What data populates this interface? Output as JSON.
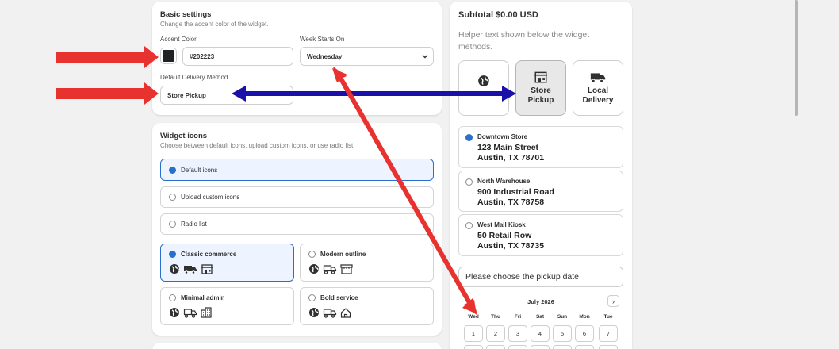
{
  "basic": {
    "title": "Basic settings",
    "subtitle": "Change the accent color of the widget.",
    "accent_label": "Accent Color",
    "accent_value": "#202223",
    "accent_color": "#202223",
    "week_label": "Week Starts On",
    "week_value": "Wednesday",
    "delivery_label": "Default Delivery Method",
    "delivery_value": "Store Pickup"
  },
  "icons": {
    "title": "Widget icons",
    "subtitle": "Choose between default icons, upload custom icons, or use radio list.",
    "options": [
      "Default icons",
      "Upload custom icons",
      "Radio list"
    ],
    "selected_option": "Default icons",
    "sets": [
      {
        "label": "Classic commerce",
        "selected": true,
        "icons": [
          "globe-icon",
          "truck-icon",
          "store-icon"
        ]
      },
      {
        "label": "Modern outline",
        "selected": false,
        "icons": [
          "globe-icon",
          "truck-outline-icon",
          "store-outline-icon"
        ]
      },
      {
        "label": "Minimal admin",
        "selected": false,
        "icons": [
          "globe-icon",
          "truck-outline-icon",
          "building-icon"
        ]
      },
      {
        "label": "Bold service",
        "selected": false,
        "icons": [
          "globe-icon",
          "truck-outline-icon",
          "house-icon"
        ]
      }
    ]
  },
  "preview": {
    "subtotal": "Subtotal $0.00 USD",
    "helper": "Helper text shown below the widget methods.",
    "methods": [
      {
        "label": "",
        "icon": "globe-icon",
        "selected": false
      },
      {
        "label": "Store Pickup",
        "icon": "store-icon",
        "selected": true
      },
      {
        "label": "Local Delivery",
        "icon": "truck-icon",
        "selected": false
      }
    ],
    "stores": [
      {
        "name": "Downtown Store",
        "line1": "123 Main Street",
        "line2": "Austin, TX 78701",
        "selected": true
      },
      {
        "name": "North Warehouse",
        "line1": "900 Industrial Road",
        "line2": "Austin, TX 78758",
        "selected": false
      },
      {
        "name": "West Mall Kiosk",
        "line1": "50 Retail Row",
        "line2": "Austin, TX 78735",
        "selected": false
      }
    ],
    "date_placeholder": "Please choose the pickup date",
    "calendar": {
      "month": "July 2026",
      "next": "›",
      "weekdays": [
        "Wed",
        "Thu",
        "Fri",
        "Sat",
        "Sun",
        "Mon",
        "Tue"
      ],
      "days": [
        "1",
        "2",
        "3",
        "4",
        "5",
        "6",
        "7"
      ]
    }
  },
  "annotation_colors": {
    "red": "#e8322f",
    "blue": "#1a12a8"
  }
}
